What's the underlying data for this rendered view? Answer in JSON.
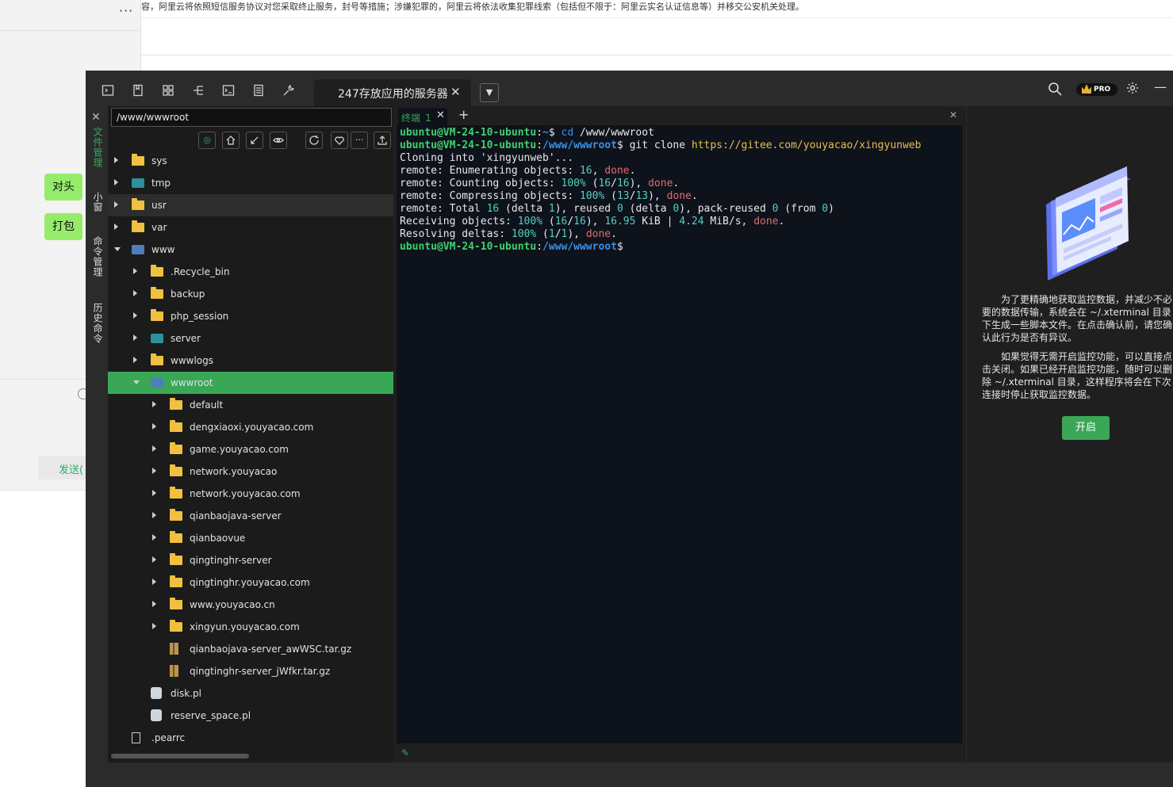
{
  "background": {
    "notice": "容，阿里云将依照短信服务协议对您采取终止服务，封号等措施；涉嫌犯罪的，阿里云将依法收集犯罪线索（包括但不限于：阿里云实名认证信息等）并移交公安机关处理。",
    "more": "···",
    "send_label": "发送(",
    "tags": [
      "对头",
      "打包"
    ]
  },
  "window": {
    "session_tab": "247存放应用的服务器",
    "pro_label": "PRO",
    "vnav": [
      "文件管理",
      "小窗",
      "命令管理",
      "历史命令"
    ]
  },
  "files": {
    "path": "/www/wwwroot",
    "tree": [
      {
        "name": "sys",
        "level": 0,
        "type": "folder",
        "arrow": "closed"
      },
      {
        "name": "tmp",
        "level": 0,
        "type": "folder-teal",
        "arrow": "closed"
      },
      {
        "name": "usr",
        "level": 0,
        "type": "folder",
        "arrow": "closed",
        "hl": true
      },
      {
        "name": "var",
        "level": 0,
        "type": "folder",
        "arrow": "closed"
      },
      {
        "name": "www",
        "level": 0,
        "type": "folder-special",
        "arrow": "open"
      },
      {
        "name": ".Recycle_bin",
        "level": 1,
        "type": "folder",
        "arrow": "closed"
      },
      {
        "name": "backup",
        "level": 1,
        "type": "folder",
        "arrow": "closed"
      },
      {
        "name": "php_session",
        "level": 1,
        "type": "folder",
        "arrow": "closed"
      },
      {
        "name": "server",
        "level": 1,
        "type": "folder-teal",
        "arrow": "closed"
      },
      {
        "name": "wwwlogs",
        "level": 1,
        "type": "folder",
        "arrow": "closed"
      },
      {
        "name": "wwwroot",
        "level": 1,
        "type": "folder-special",
        "arrow": "open",
        "sel": true
      },
      {
        "name": "default",
        "level": 2,
        "type": "folder",
        "arrow": "closed"
      },
      {
        "name": "dengxiaoxi.youyacao.com",
        "level": 2,
        "type": "folder",
        "arrow": "closed"
      },
      {
        "name": "game.youyacao.com",
        "level": 2,
        "type": "folder",
        "arrow": "closed"
      },
      {
        "name": "network.youyacao",
        "level": 2,
        "type": "folder",
        "arrow": "closed"
      },
      {
        "name": "network.youyacao.com",
        "level": 2,
        "type": "folder",
        "arrow": "closed"
      },
      {
        "name": "qianbaojava-server",
        "level": 2,
        "type": "folder",
        "arrow": "closed"
      },
      {
        "name": "qianbaovue",
        "level": 2,
        "type": "folder",
        "arrow": "closed"
      },
      {
        "name": "qingtinghr-server",
        "level": 2,
        "type": "folder",
        "arrow": "closed"
      },
      {
        "name": "qingtinghr.youyacao.com",
        "level": 2,
        "type": "folder",
        "arrow": "closed"
      },
      {
        "name": "www.youyacao.cn",
        "level": 2,
        "type": "folder",
        "arrow": "closed"
      },
      {
        "name": "xingyun.youyacao.com",
        "level": 2,
        "type": "folder",
        "arrow": "closed"
      },
      {
        "name": "qianbaojava-server_awWSC.tar.gz",
        "level": 2,
        "type": "archive",
        "arrow": "none"
      },
      {
        "name": "qingtinghr-server_jWfkr.tar.gz",
        "level": 2,
        "type": "archive",
        "arrow": "none"
      },
      {
        "name": "disk.pl",
        "level": 1,
        "type": "script",
        "arrow": "none"
      },
      {
        "name": "reserve_space.pl",
        "level": 1,
        "type": "script",
        "arrow": "none"
      },
      {
        "name": ".pearrc",
        "level": 0,
        "type": "file",
        "arrow": "none"
      }
    ]
  },
  "terminal": {
    "tab_label": "终端",
    "tab_num": "1",
    "prompt1_user": "ubuntu@VM-24-10-ubuntu",
    "prompt1_path": "~",
    "cmd1_cd": "cd",
    "cmd1_arg": "/www/wwwroot",
    "prompt2_path": "/www/wwwroot",
    "cmd2": "git clone ",
    "cmd2_url": "https://gitee.com/youyacao/xingyunweb",
    "cloning": "Cloning into 'xingyunweb'...",
    "enum_prefix": "remote: Enumerating objects: ",
    "enum_num": "16",
    "count_prefix": "remote: Counting objects: ",
    "count_pct": "100%",
    "count_a": "16",
    "count_b": "16",
    "compress_prefix": "remote: Compressing objects: ",
    "compress_pct": "100%",
    "compress_a": "13",
    "compress_b": "13",
    "total_prefix": "remote: Total ",
    "total_num": "16",
    "delta_label": " (delta ",
    "delta1": "1",
    "reused_label": "), reused ",
    "reused_num": "0",
    "delta2": "0",
    "pack_label": "), pack-reused ",
    "pack_num": "0",
    "from_label": " (from ",
    "from_num": "0",
    "recv_prefix": "Receiving objects: ",
    "recv_pct": "100%",
    "recv_a": "16",
    "recv_b": "16",
    "recv_size": "16.95",
    "recv_unit": " KiB | ",
    "recv_speed": "4.24",
    "recv_speed_unit": " MiB/s, ",
    "resolve_prefix": "Resolving deltas: ",
    "resolve_pct": "100%",
    "resolve_a": "1",
    "resolve_b": "1",
    "done": "done",
    "prompt3_path": "/www/wwwroot"
  },
  "monitor": {
    "para1": "为了更精确地获取监控数据，并减少不必要的数据传输，系统会在 ~/.xterminal 目录下生成一些脚本文件。在点击确认前，请您确认此行为是否有异议。",
    "para2": "如果觉得无需开启监控功能，可以直接点击关闭。如果已经开启监控功能，随时可以删除 ~/.xterminal 目录，这样程序将会在下次连接时停止获取监控数据。",
    "button": "开启"
  }
}
